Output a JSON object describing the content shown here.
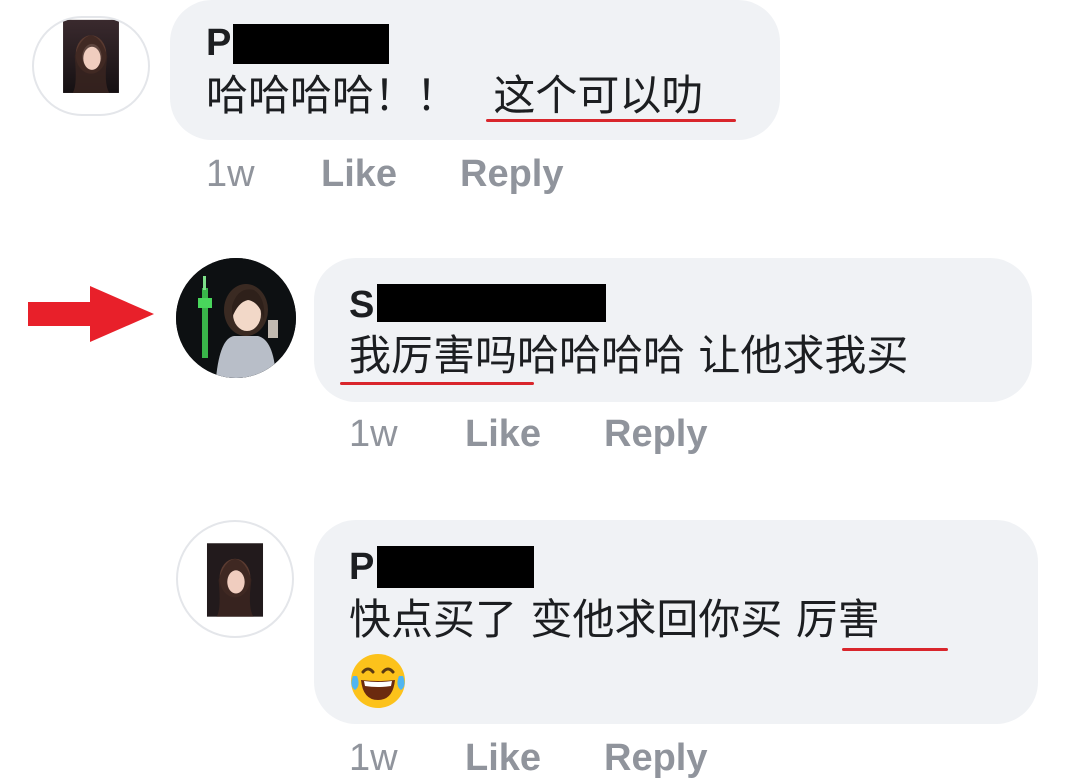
{
  "comments": [
    {
      "author_initial": "P",
      "text_prefix": "哈哈哈哈！！",
      "text_underlined": "这个可以叻",
      "time": "1w",
      "like_label": "Like",
      "reply_label": "Reply"
    },
    {
      "author_initial": "S",
      "text_underlined": "我厉害吗",
      "text_suffix": "哈哈哈哈 让他求我买",
      "time": "1w",
      "like_label": "Like",
      "reply_label": "Reply"
    },
    {
      "author_initial": "P",
      "text_prefix": "快点买了 变他求回你买",
      "text_underlined": "厉害",
      "emoji": "laughing-tears-emoji",
      "time": "1w",
      "like_label": "Like",
      "reply_label": "Reply"
    }
  ],
  "colors": {
    "bubble": "#f0f2f5",
    "meta": "#90949c",
    "underline": "#d9262c",
    "arrow": "#e8202a"
  },
  "icons": {
    "pointer": "red-arrow-icon"
  }
}
